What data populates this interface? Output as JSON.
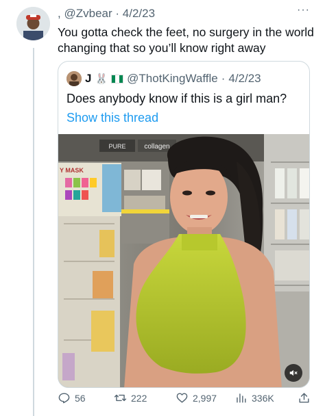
{
  "tweet": {
    "display_name": ",",
    "handle": "@Zvbear",
    "date": "4/2/23",
    "text": "You gotta check the feet, no surgery in the world changing that so you’ll know right away",
    "more_label": "···"
  },
  "quoted": {
    "display_name": "J",
    "emoji": "🐰",
    "handle": "@ThotKingWaffle",
    "date": "4/2/23",
    "text": "Does anybody know if this is a girl man?",
    "show_thread": "Show this thread",
    "media": {
      "store_sign_1": "PURE",
      "store_sign_2": "collagen",
      "shelf_sign": "Y MASK",
      "mute_icon": "mute-icon"
    }
  },
  "actions": {
    "replies": "56",
    "retweets": "222",
    "likes": "2,997",
    "views": "336K"
  },
  "colors": {
    "text": "#0f1419",
    "secondary": "#536471",
    "link": "#1d9bf0",
    "border": "#cfd9de"
  }
}
